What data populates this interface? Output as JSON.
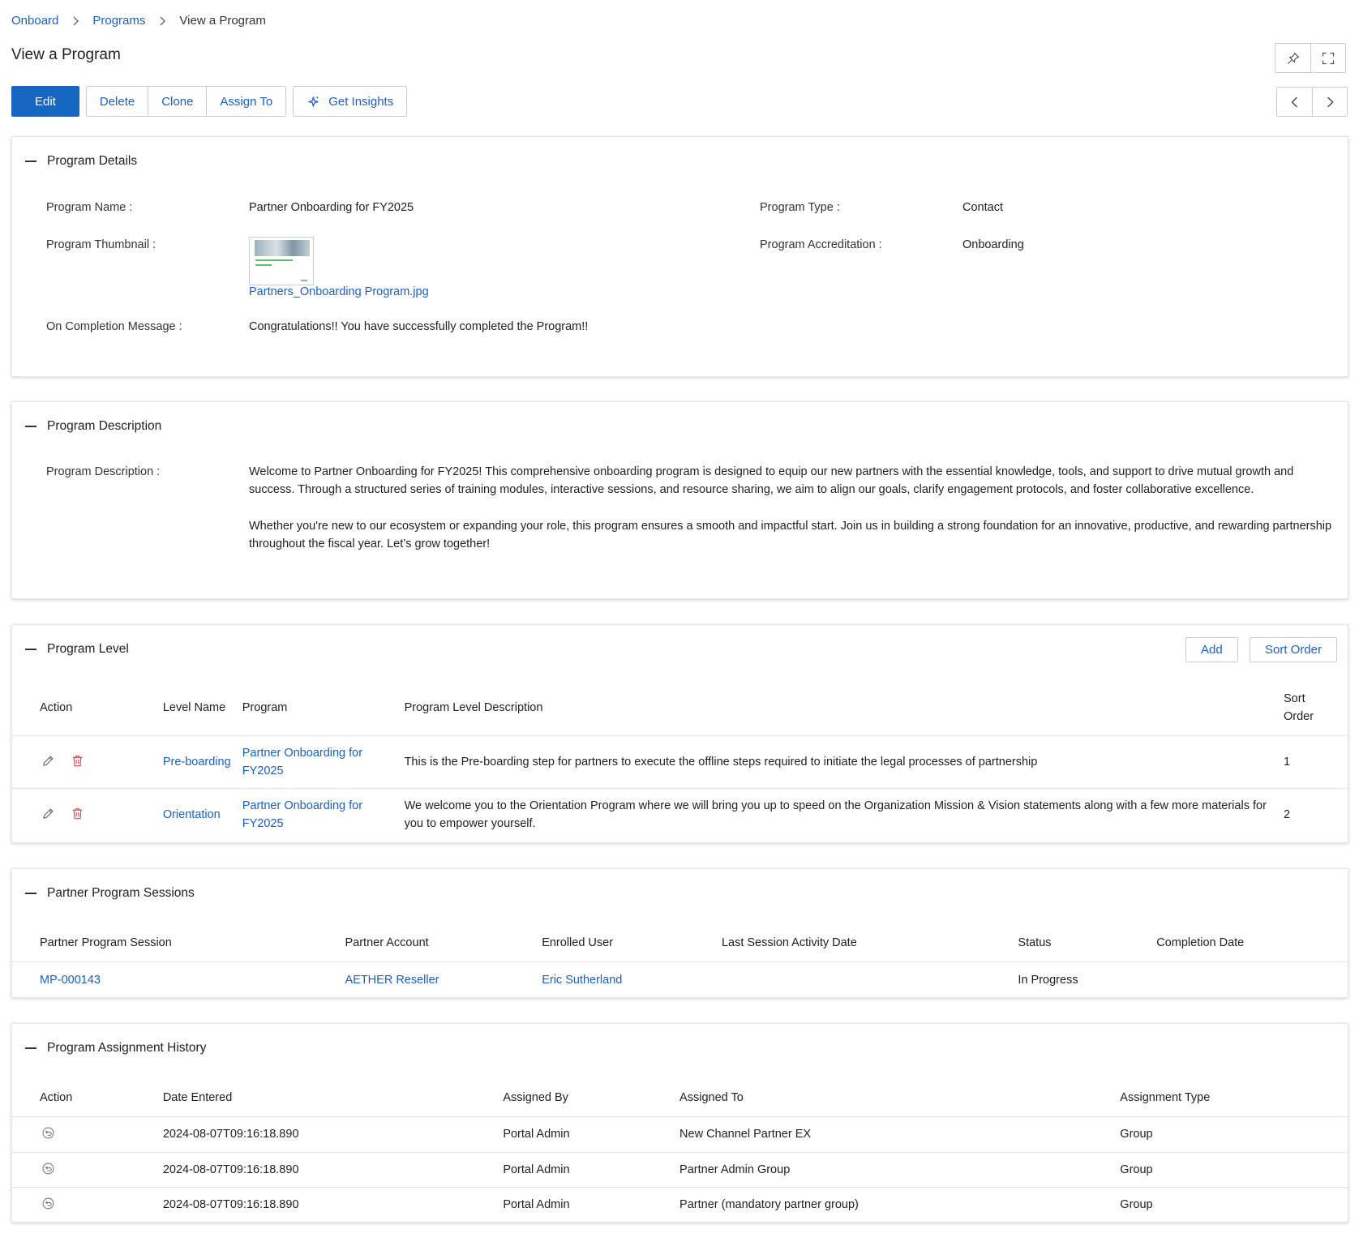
{
  "breadcrumb": [
    "Onboard",
    "Programs",
    "View a Program"
  ],
  "page_title": "View a Program",
  "toolbar": {
    "edit": "Edit",
    "delete": "Delete",
    "clone": "Clone",
    "assign_to": "Assign To",
    "get_insights": "Get Insights"
  },
  "details": {
    "title": "Program Details",
    "program_name_label": "Program Name :",
    "program_name": "Partner Onboarding for FY2025",
    "program_type_label": "Program Type :",
    "program_type": "Contact",
    "thumbnail_label": "Program Thumbnail :",
    "thumbnail_file": "Partners_Onboarding Program.jpg",
    "accreditation_label": "Program Accreditation :",
    "accreditation": "Onboarding",
    "completion_label": "On Completion Message :",
    "completion_message": "Congratulations!! You have successfully completed the Program!!"
  },
  "description": {
    "title": "Program Description",
    "label": "Program Description :",
    "paragraph1": "Welcome to Partner Onboarding for FY2025! This comprehensive onboarding program is designed to equip our new partners with the essential knowledge, tools, and support to drive mutual growth and success. Through a structured series of training modules, interactive sessions, and resource sharing, we aim to align our goals, clarify engagement protocols, and foster collaborative excellence.",
    "paragraph2": "Whether you're new to our ecosystem or expanding your role, this program ensures a smooth and impactful start. Join us in building a strong foundation for an innovative, productive, and rewarding partnership throughout the fiscal year. Let’s grow together!"
  },
  "levels": {
    "title": "Program Level",
    "add": "Add",
    "sort_order_btn": "Sort Order",
    "columns": {
      "action": "Action",
      "level_name": "Level Name",
      "program": "Program",
      "description": "Program Level Description",
      "sort_order": "Sort Order"
    },
    "rows": [
      {
        "level_name": "Pre-boarding",
        "program": "Partner Onboarding for FY2025",
        "description": "This is the Pre-boarding step for partners to execute the offline steps required to initiate the legal processes of partnership",
        "sort_order": "1"
      },
      {
        "level_name": "Orientation",
        "program": "Partner Onboarding for FY2025",
        "description": "We welcome you to the Orientation Program where we will bring you up to speed on the Organization Mission & Vision statements along with a few more materials for you to empower yourself.",
        "sort_order": "2"
      }
    ]
  },
  "sessions": {
    "title": "Partner Program Sessions",
    "columns": {
      "session": "Partner Program Session",
      "account": "Partner Account",
      "user": "Enrolled User",
      "last_activity": "Last Session Activity Date",
      "status": "Status",
      "completion": "Completion Date"
    },
    "rows": [
      {
        "session": "MP-000143",
        "account": "AETHER Reseller",
        "user": "Eric Sutherland",
        "last_activity": "",
        "status": "In Progress",
        "completion": ""
      }
    ]
  },
  "history": {
    "title": "Program Assignment History",
    "columns": {
      "action": "Action",
      "date": "Date Entered",
      "assigned_by": "Assigned By",
      "assigned_to": "Assigned To",
      "type": "Assignment Type"
    },
    "rows": [
      {
        "date": "2024-08-07T09:16:18.890",
        "assigned_by": "Portal Admin",
        "assigned_to": "New Channel Partner EX",
        "type": "Group"
      },
      {
        "date": "2024-08-07T09:16:18.890",
        "assigned_by": "Portal Admin",
        "assigned_to": "Partner Admin Group",
        "type": "Group"
      },
      {
        "date": "2024-08-07T09:16:18.890",
        "assigned_by": "Portal Admin",
        "assigned_to": "Partner (mandatory partner group)",
        "type": "Group"
      }
    ]
  },
  "icons": {
    "pin": "pin-icon",
    "fullscreen": "fullscreen-icon",
    "prev": "chevron-left-icon",
    "next": "chevron-right-icon",
    "insights": "sparkle-icon",
    "edit": "pencil-icon",
    "delete": "trash-icon",
    "revert": "undo-icon"
  },
  "colors": {
    "accent": "#1766c2",
    "link": "#1a5fc7",
    "danger": "#e04545"
  }
}
